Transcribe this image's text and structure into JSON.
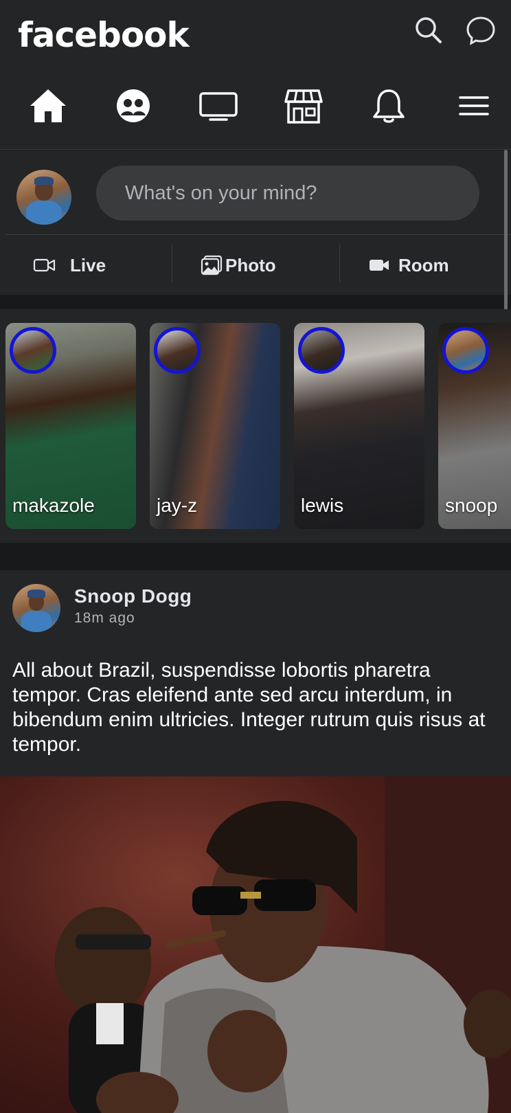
{
  "app": {
    "brand": "facebook",
    "colors": {
      "background": "#18191a",
      "surface": "#242526",
      "story_ring": "#1414d4",
      "input_bg": "#3a3b3c"
    }
  },
  "header": {
    "icons": [
      "search-icon",
      "messenger-icon"
    ]
  },
  "nav": {
    "items": [
      {
        "name": "home",
        "icon": "home-icon"
      },
      {
        "name": "groups",
        "icon": "groups-icon"
      },
      {
        "name": "watch",
        "icon": "video-tv-icon"
      },
      {
        "name": "marketplace",
        "icon": "marketplace-store-icon"
      },
      {
        "name": "notifications",
        "icon": "bell-icon"
      },
      {
        "name": "menu",
        "icon": "hamburger-menu-icon"
      }
    ]
  },
  "composer": {
    "placeholder": "What's on your mind?",
    "actions": [
      {
        "label": "Live",
        "icon": "video-camera-outline-icon"
      },
      {
        "label": "Photo",
        "icon": "photo-icon"
      },
      {
        "label": "Room",
        "icon": "video-camera-filled-icon"
      }
    ]
  },
  "stories": [
    {
      "name": "makazole"
    },
    {
      "name": "jay-z"
    },
    {
      "name": "lewis"
    },
    {
      "name": "snoop"
    }
  ],
  "post": {
    "author": "Snoop Dogg",
    "time": "18m ago",
    "text": "All about Brazil, suspendisse lobortis pharetra tempor. Cras eleifend ante sed arcu interdum, in bibendum enim ultricies. Integer rutrum quis risus at tempor."
  }
}
